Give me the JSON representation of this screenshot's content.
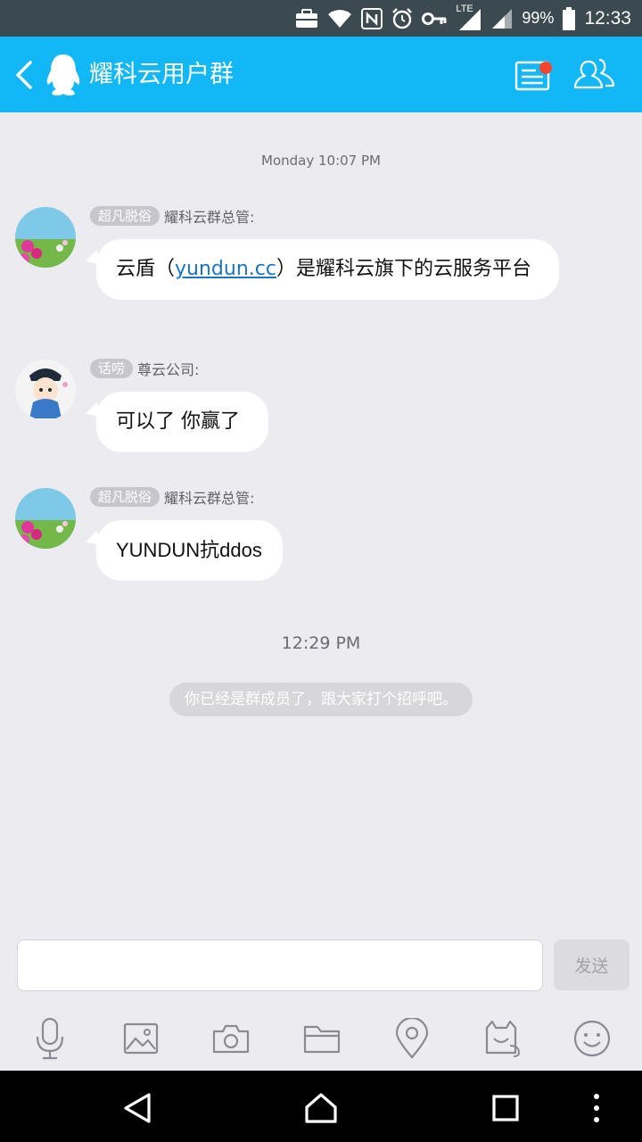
{
  "status_bar": {
    "network_label": "LTE",
    "battery": "99%",
    "time": "12:33",
    "icons": [
      "briefcase-icon",
      "wifi-icon",
      "nfc-icon",
      "alarm-icon",
      "key-icon",
      "lte-signal-icon",
      "signal-icon",
      "battery-icon"
    ]
  },
  "header": {
    "title": "耀科云用户群",
    "icons": [
      "back-icon",
      "qq-penguin-icon",
      "group-notice-icon",
      "group-members-icon"
    ],
    "accent": "#12b7f5",
    "notice_dot_color": "#f5462d"
  },
  "chat": {
    "timestamps": [
      "Monday 10:07 PM",
      "12:29 PM"
    ],
    "messages": [
      {
        "badge": "超凡脱俗",
        "sender": "耀科云群总管:",
        "text_before": "云盾（",
        "link": "yundun.cc",
        "text_after": "）是耀科云旗下的云服务平台"
      },
      {
        "badge": "话唠",
        "sender": "尊云公司:",
        "text": "可以了  你赢了"
      },
      {
        "badge": "超凡脱俗",
        "sender": "耀科云群总管:",
        "text": "YUNDUN抗ddos"
      }
    ],
    "system_note": "你已经是群成员了，跟大家打个招呼吧。"
  },
  "input": {
    "value": "",
    "placeholder": "",
    "send_label": "发送"
  },
  "toolbar": {
    "icons": [
      "microphone-icon",
      "image-icon",
      "camera-icon",
      "folder-icon",
      "location-icon",
      "red-packet-icon",
      "emoji-icon"
    ]
  },
  "nav_bar": {
    "icons": [
      "nav-back-icon",
      "nav-home-icon",
      "nav-recents-icon",
      "nav-more-icon"
    ]
  }
}
